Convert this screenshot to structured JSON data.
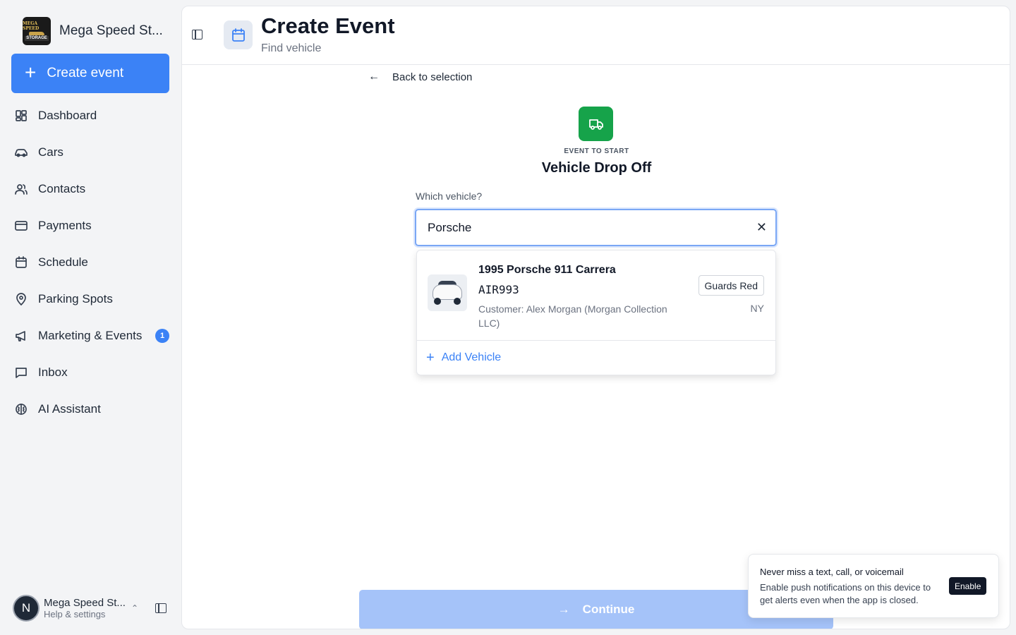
{
  "brand": {
    "name": "Mega Speed St...",
    "logo_text": [
      "MEGA SPEED",
      "STORAGE"
    ]
  },
  "sidebar": {
    "create_label": "Create event",
    "items": [
      {
        "label": "Dashboard",
        "icon": "dashboard-icon"
      },
      {
        "label": "Cars",
        "icon": "car-icon"
      },
      {
        "label": "Contacts",
        "icon": "contacts-icon"
      },
      {
        "label": "Payments",
        "icon": "credit-card-icon"
      },
      {
        "label": "Schedule",
        "icon": "calendar-icon"
      },
      {
        "label": "Parking Spots",
        "icon": "map-pin-icon"
      },
      {
        "label": "Marketing & Events",
        "icon": "megaphone-icon",
        "badge": "1"
      },
      {
        "label": "Inbox",
        "icon": "message-icon"
      },
      {
        "label": "AI Assistant",
        "icon": "brain-icon"
      }
    ]
  },
  "user": {
    "initial": "N",
    "name": "Mega Speed St...",
    "sub": "Help & settings"
  },
  "header": {
    "title": "Create Event",
    "subtitle": "Find vehicle"
  },
  "back_label": "Back to selection",
  "event": {
    "caption": "EVENT TO START",
    "name": "Vehicle Drop Off"
  },
  "search": {
    "label": "Which vehicle?",
    "value": "Porsche"
  },
  "results": [
    {
      "title": "1995 Porsche 911 Carrera",
      "plate": "AIR993",
      "customer": "Customer: Alex Morgan (Morgan Collection LLC)",
      "color": "Guards Red",
      "state": "NY"
    }
  ],
  "add_vehicle_label": "Add Vehicle",
  "continue_label": "Continue",
  "toast": {
    "title": "Never miss a text, call, or voicemail",
    "body": "Enable push notifications on this device to get alerts even when the app is closed.",
    "button": "Enable"
  },
  "colors": {
    "accent": "#3b82f6",
    "event": "#16a34a",
    "continue_disabled": "#a5c3f9"
  }
}
